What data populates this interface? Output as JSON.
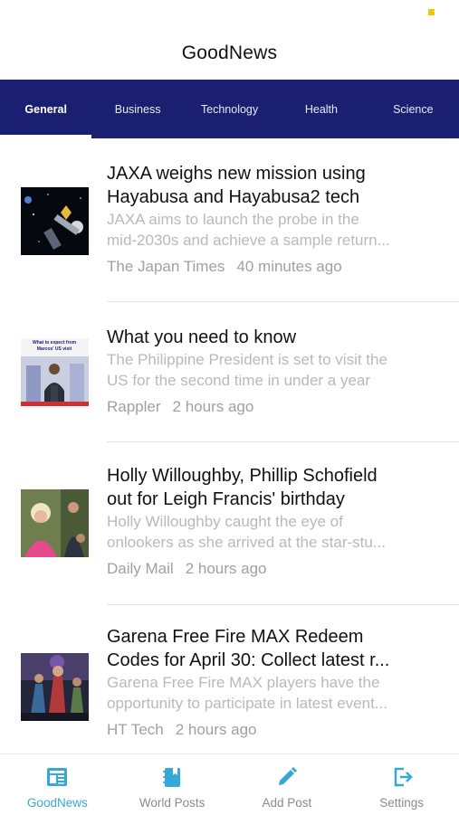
{
  "app": {
    "title": "GoodNews"
  },
  "tabs": [
    {
      "label": "General",
      "active": true
    },
    {
      "label": "Business",
      "active": false
    },
    {
      "label": "Technology",
      "active": false
    },
    {
      "label": "Health",
      "active": false
    },
    {
      "label": "Science",
      "active": false
    }
  ],
  "articles": [
    {
      "title_lines": [
        "JAXA weighs new mission using",
        "Hayabusa and Hayabusa2 tech"
      ],
      "desc_lines": [
        "JAXA aims to launch the probe in the",
        "mid-2030s and achieve a sample return..."
      ],
      "source": "The Japan Times",
      "time": "40 minutes ago",
      "thumb_icon": "space-probe-image"
    },
    {
      "title_lines": [
        "What you need to know"
      ],
      "desc_lines": [
        "The Philippine President is set to visit the",
        "US for the second time in under a year"
      ],
      "source": "Rappler",
      "time": "2 hours ago",
      "thumb_icon": "president-podium-image",
      "thumb_caption_lines": [
        "What to expect from",
        "Marcos' US visit"
      ]
    },
    {
      "title_lines": [
        "Holly Willoughby, Phillip Schofield",
        "out for Leigh Francis' birthday"
      ],
      "desc_lines": [
        "Holly Willoughby caught the eye of",
        "onlookers as she arrived at the star-stu..."
      ],
      "source": "Daily Mail",
      "time": "2 hours ago",
      "thumb_icon": "celebrity-photo-image"
    },
    {
      "title_lines": [
        "Garena Free Fire MAX Redeem",
        "Codes for April 30: Collect latest r..."
      ],
      "desc_lines": [
        "Garena Free Fire MAX players have the",
        "opportunity to participate in latest event..."
      ],
      "source": "HT Tech",
      "time": "2 hours ago",
      "thumb_icon": "game-characters-image"
    }
  ],
  "bottom_nav": [
    {
      "label": "GoodNews",
      "icon": "newspaper-icon",
      "active": true
    },
    {
      "label": "World Posts",
      "icon": "notebook-icon",
      "active": false
    },
    {
      "label": "Add Post",
      "icon": "pencil-icon",
      "active": false
    },
    {
      "label": "Settings",
      "icon": "logout-icon",
      "active": false
    }
  ],
  "colors": {
    "tab_bar_bg": "#1a1f71",
    "nav_active": "#35a8d8",
    "nav_inactive": "#8a8a8a",
    "battery": "#f2c500"
  }
}
